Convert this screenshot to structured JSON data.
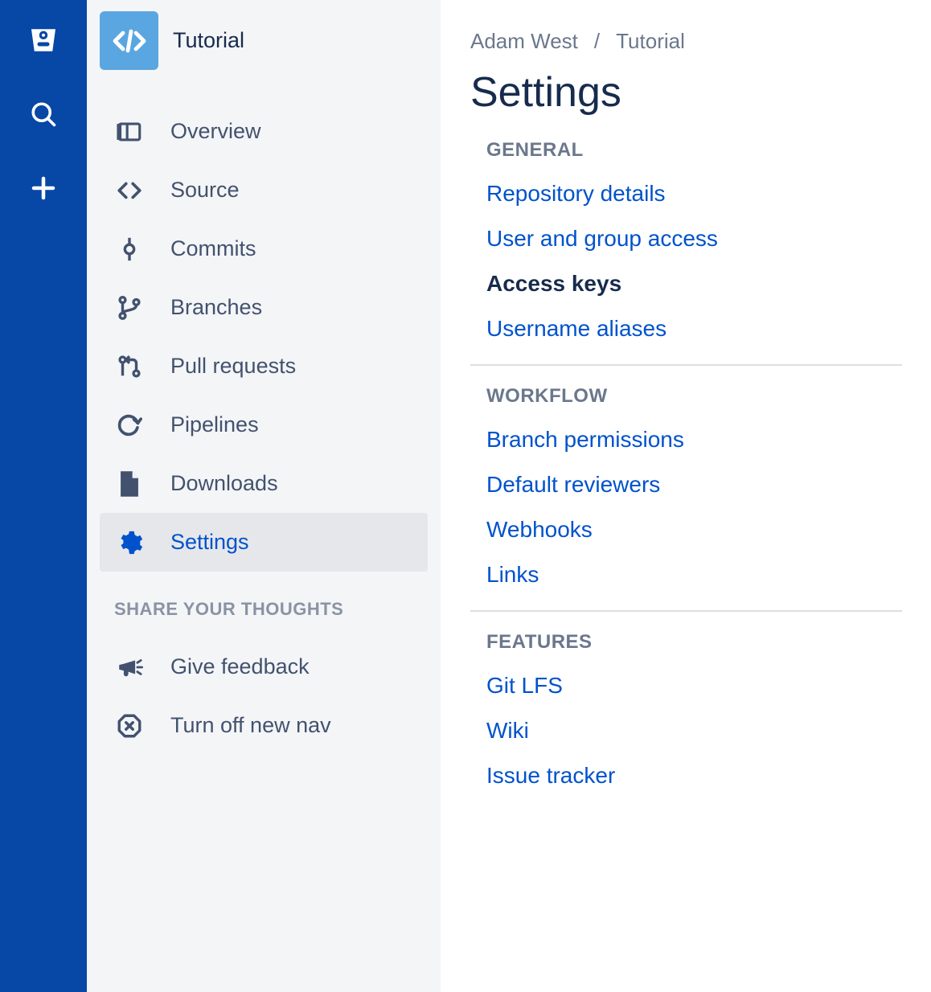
{
  "rail": {
    "logo": "bitbucket",
    "search": "search",
    "create": "create"
  },
  "repo": {
    "name": "Tutorial"
  },
  "sidebar": {
    "items": [
      {
        "icon": "overview",
        "label": "Overview"
      },
      {
        "icon": "source",
        "label": "Source"
      },
      {
        "icon": "commits",
        "label": "Commits"
      },
      {
        "icon": "branches",
        "label": "Branches"
      },
      {
        "icon": "pull-requests",
        "label": "Pull requests"
      },
      {
        "icon": "pipelines",
        "label": "Pipelines"
      },
      {
        "icon": "downloads",
        "label": "Downloads"
      },
      {
        "icon": "settings",
        "label": "Settings"
      }
    ],
    "thoughts_heading": "SHARE YOUR THOUGHTS",
    "feedback": {
      "label": "Give feedback"
    },
    "turn_off": {
      "label": "Turn off new nav"
    }
  },
  "breadcrumb": {
    "owner": "Adam West",
    "separator": "/",
    "repo": "Tutorial"
  },
  "page_title": "Settings",
  "settings_groups": [
    {
      "heading": "GENERAL",
      "items": [
        {
          "label": "Repository details",
          "active": false
        },
        {
          "label": "User and group access",
          "active": false
        },
        {
          "label": "Access keys",
          "active": true
        },
        {
          "label": "Username aliases",
          "active": false
        }
      ]
    },
    {
      "heading": "WORKFLOW",
      "items": [
        {
          "label": "Branch permissions",
          "active": false
        },
        {
          "label": "Default reviewers",
          "active": false
        },
        {
          "label": "Webhooks",
          "active": false
        },
        {
          "label": "Links",
          "active": false
        }
      ]
    },
    {
      "heading": "FEATURES",
      "items": [
        {
          "label": "Git LFS",
          "active": false
        },
        {
          "label": "Wiki",
          "active": false
        },
        {
          "label": "Issue tracker",
          "active": false
        }
      ]
    }
  ]
}
